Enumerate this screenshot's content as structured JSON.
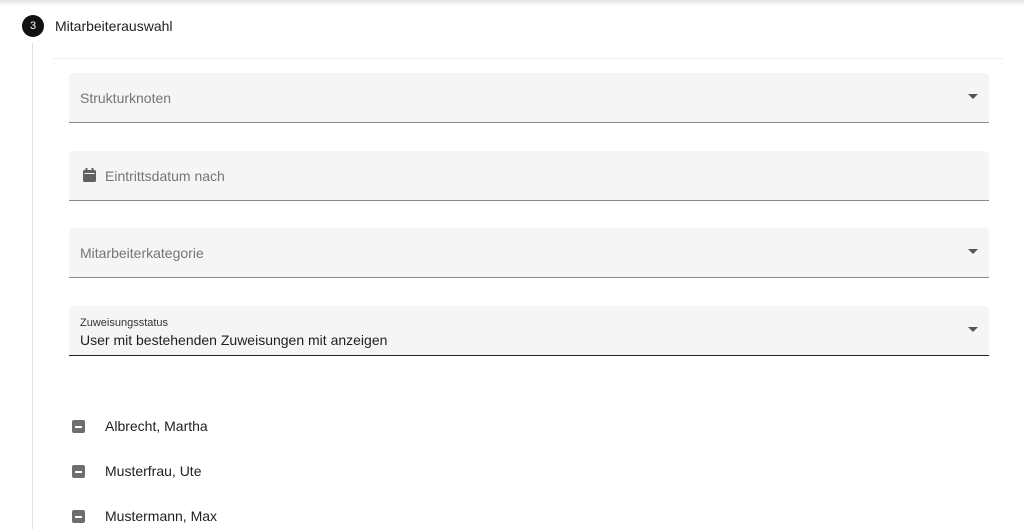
{
  "step": {
    "number": "3",
    "title": "Mitarbeiterauswahl"
  },
  "filters": {
    "strukturknoten": {
      "placeholder": "Strukturknoten"
    },
    "eintrittsdatum": {
      "placeholder": "Eintrittsdatum nach",
      "icon": "calendar-icon"
    },
    "mitarbeiterkategorie": {
      "placeholder": "Mitarbeiterkategorie"
    },
    "zuweisungsstatus": {
      "label": "Zuweisungsstatus",
      "value": "User mit bestehenden Zuweisungen mit anzeigen"
    }
  },
  "employees": [
    {
      "name": "Albrecht, Martha",
      "state": "indeterminate"
    },
    {
      "name": "Musterfrau, Ute",
      "state": "indeterminate"
    },
    {
      "name": "Mustermann, Max",
      "state": "indeterminate"
    }
  ],
  "colors": {
    "step_circle": "#111111",
    "field_bg": "#f5f5f5",
    "checkbox": "#6e6e6e"
  }
}
